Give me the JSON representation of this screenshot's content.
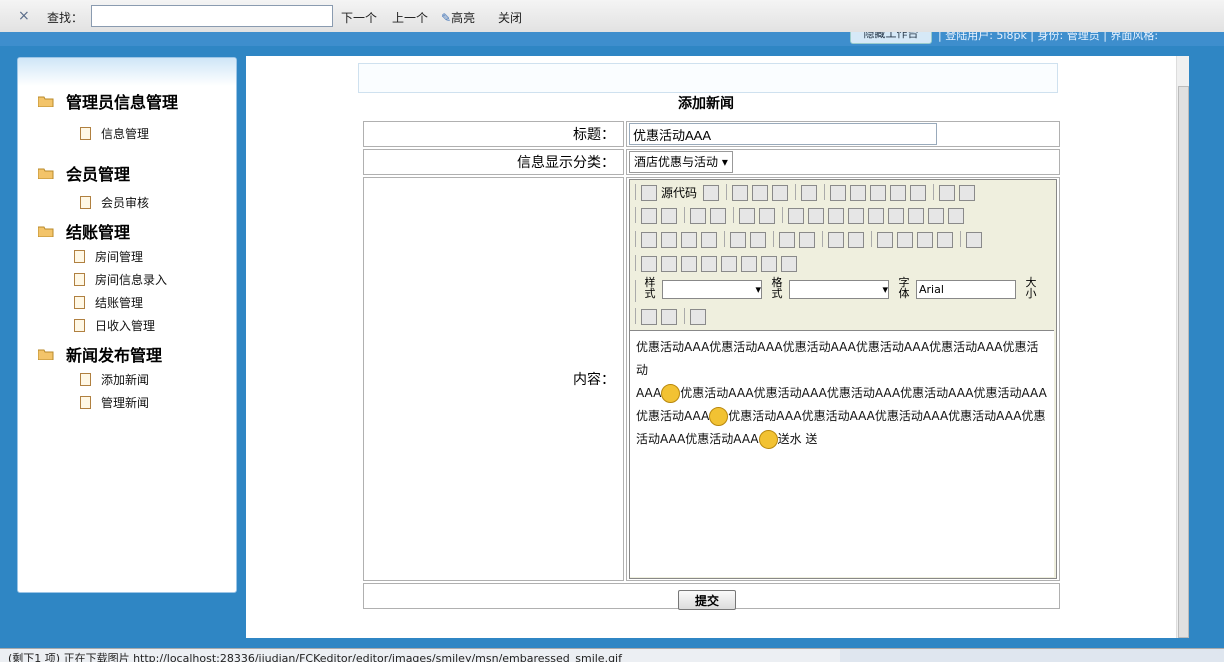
{
  "find_bar": {
    "close_glyph": "×",
    "label": "查找：",
    "value": "",
    "next": "下一个",
    "prev": "上一个",
    "highlight": "高亮",
    "close": "关闭"
  },
  "header": {
    "tag": "隐藏工作台",
    "info": "| 登陆用户: 5i8pk | 身份: 管理员 | 界面风格:"
  },
  "sidebar": {
    "groups": [
      {
        "label": "管理员信息管理",
        "items": [
          "信息管理"
        ]
      },
      {
        "label": "会员管理",
        "items": [
          "会员审核"
        ]
      },
      {
        "label": "结账管理",
        "items": [
          "房间管理",
          "房间信息录入",
          "结账管理",
          "日收入管理"
        ]
      },
      {
        "label": "新闻发布管理",
        "items": [
          "添加新闻",
          "管理新闻"
        ]
      }
    ]
  },
  "form": {
    "page_title": "添加新闻",
    "title_label": "标题：",
    "title_value": "优惠活动AAA",
    "category_label": "信息显示分类：",
    "category_value": "酒店优惠与活动",
    "content_label": "内容：",
    "submit": "提交"
  },
  "editor": {
    "source_label": "源代码",
    "style_label": "样式",
    "format_label": "格式",
    "font_label": "字体",
    "font_value": "Arial",
    "size_label": "大小",
    "content_lines": [
      "优惠活动AAA优惠活动AAA优惠活动AAA优惠活动AAA优惠活动AAA优惠活动",
      "AAA",
      "优惠活动AAA优惠活动AAA优惠活动AAA优惠活动AAA优惠活动AAA",
      "优惠活动AAA",
      "优惠活动AAA优惠活动AAA优惠活动AAA优惠活动AAA优惠",
      "活动AAA优惠活动AAA",
      "送水 送"
    ]
  },
  "status_bar": {
    "text": "(剩下1 项) 正在下载图片 http://localhost:28336/jiudian/FCKeditor/editor/images/smiley/msn/embaressed_smile.gif"
  },
  "colors": {
    "accent": "#2f86c4"
  }
}
